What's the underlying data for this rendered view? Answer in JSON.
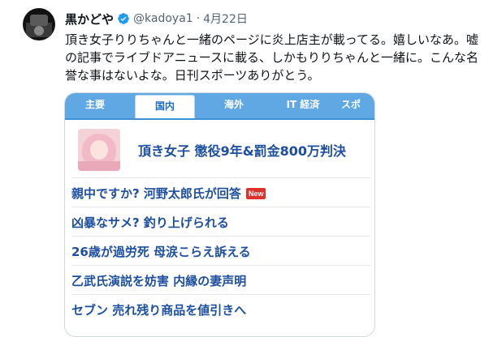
{
  "tweet": {
    "display_name": "黒かどや",
    "handle": "@kadoya1",
    "separator": "·",
    "date": "4月22日",
    "text": "頂き女子りりちゃんと一緒のページに炎上店主が載ってる。嬉しいなあ。嘘の記事でライブドアニュースに載る、しかもりりちゃんと一緒に。こんな名誉な事はないよな。日刊スポーツありがとう。"
  },
  "colors": {
    "verified": "#1d9bf0",
    "tab_bar": "#5fa8e4",
    "link": "#1d4fa0",
    "badge": "#e0322c"
  },
  "card": {
    "tabs": [
      {
        "label": "主要",
        "active": false
      },
      {
        "label": "国内",
        "active": true
      },
      {
        "label": "海外",
        "active": false
      },
      {
        "label": "IT 経済",
        "active": false
      },
      {
        "label": "スポ",
        "active": false
      }
    ],
    "top_headline": "頂き女子 懲役9年&罰金800万判決",
    "news": [
      {
        "title": "親中ですか? 河野太郎氏が回答",
        "badge": "New"
      },
      {
        "title": "凶暴なサメ? 釣り上げられる",
        "badge": ""
      },
      {
        "title": "26歳が過労死 母涙こらえ訴える",
        "badge": ""
      },
      {
        "title": "乙武氏演説を妨害 内縁の妻声明",
        "badge": ""
      },
      {
        "title": "セブン 売れ残り商品を値引きへ",
        "badge": ""
      }
    ]
  }
}
